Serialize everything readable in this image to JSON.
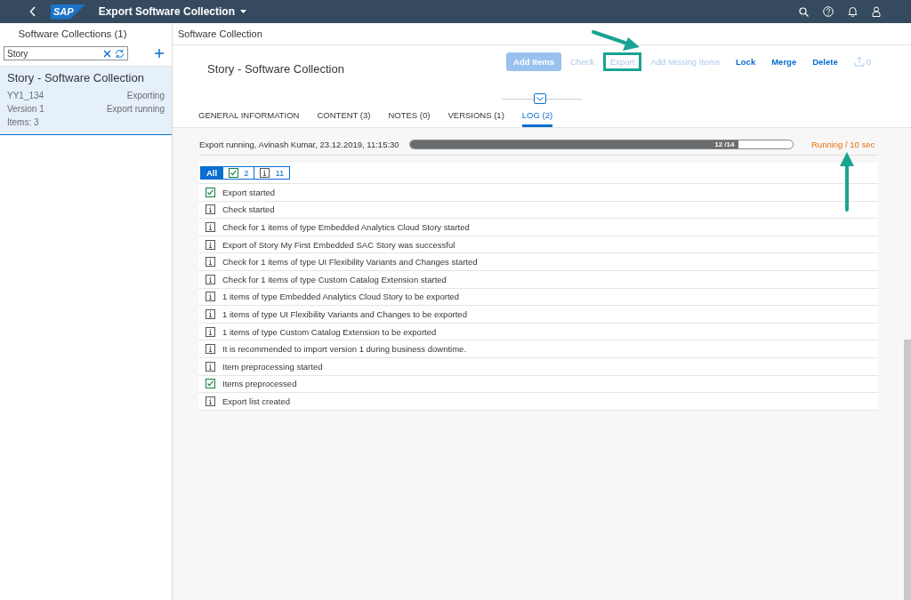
{
  "shell": {
    "logo": "SAP",
    "title": "Export Software Collection"
  },
  "master": {
    "title": "Software Collections (1)",
    "search": {
      "value": "Story"
    },
    "items": [
      {
        "title": "Story - Software Collection",
        "id": "YY1_134",
        "status": "Exporting",
        "version": "Version 1",
        "substatus": "Export running",
        "count": "Items: 3",
        "selected": true
      }
    ]
  },
  "detail": {
    "header": "Software Collection",
    "title": "Story - Software Collection",
    "actions": [
      {
        "label": "Add Items",
        "kind": "emphasized",
        "disabled": true,
        "highlighted": false
      },
      {
        "label": "Check",
        "kind": "plain",
        "disabled": true,
        "highlighted": false
      },
      {
        "label": "Export",
        "kind": "plain",
        "disabled": true,
        "highlighted": true
      },
      {
        "label": "Add Missing Items",
        "kind": "plain",
        "disabled": true,
        "highlighted": false
      },
      {
        "label": "Lock",
        "kind": "plain",
        "disabled": false,
        "highlighted": false
      },
      {
        "label": "Merge",
        "kind": "plain",
        "disabled": false,
        "highlighted": false
      },
      {
        "label": "Delete",
        "kind": "plain",
        "disabled": false,
        "highlighted": false
      },
      {
        "label": "0",
        "kind": "share",
        "disabled": true,
        "highlighted": false
      }
    ],
    "tabs": [
      {
        "label": "GENERAL INFORMATION",
        "selected": false
      },
      {
        "label": "CONTENT (3)",
        "selected": false
      },
      {
        "label": "NOTES (0)",
        "selected": false
      },
      {
        "label": "VERSIONS (1)",
        "selected": false
      },
      {
        "label": "LOG (2)",
        "selected": true
      }
    ],
    "log": {
      "status": "Export running, Avinash Kumar, 23.12.2019, 11:15:30",
      "progress": {
        "level": 0.857,
        "text": "12 /14"
      },
      "state": "Running / 10 sec",
      "filters": [
        {
          "kind": "all",
          "label": "All",
          "selected": true
        },
        {
          "kind": "success",
          "label": "2",
          "selected": false
        },
        {
          "kind": "info",
          "label": "11",
          "selected": false
        }
      ],
      "entries": [
        {
          "kind": "success",
          "text": "Export started"
        },
        {
          "kind": "info",
          "text": "Check started"
        },
        {
          "kind": "info",
          "text": "Check for 1 items of type Embedded Analytics Cloud Story started"
        },
        {
          "kind": "info",
          "text": "Export of Story My First Embedded SAC Story was successful"
        },
        {
          "kind": "info",
          "text": "Check for 1 items of type UI Flexibility Variants and Changes started"
        },
        {
          "kind": "info",
          "text": "Check for 1 items of type Custom Catalog Extension started"
        },
        {
          "kind": "info",
          "text": "1 items of type Embedded Analytics Cloud Story to be exported"
        },
        {
          "kind": "info",
          "text": "1 items of type UI Flexibility Variants and Changes to be exported"
        },
        {
          "kind": "info",
          "text": "1 items of type Custom Catalog Extension to be exported"
        },
        {
          "kind": "info",
          "text": "It is recommended to import version 1 during business downtime."
        },
        {
          "kind": "info",
          "text": "Item preprocessing started"
        },
        {
          "kind": "success",
          "text": "Items preprocessed"
        },
        {
          "kind": "info",
          "text": "Export list created"
        }
      ]
    }
  }
}
